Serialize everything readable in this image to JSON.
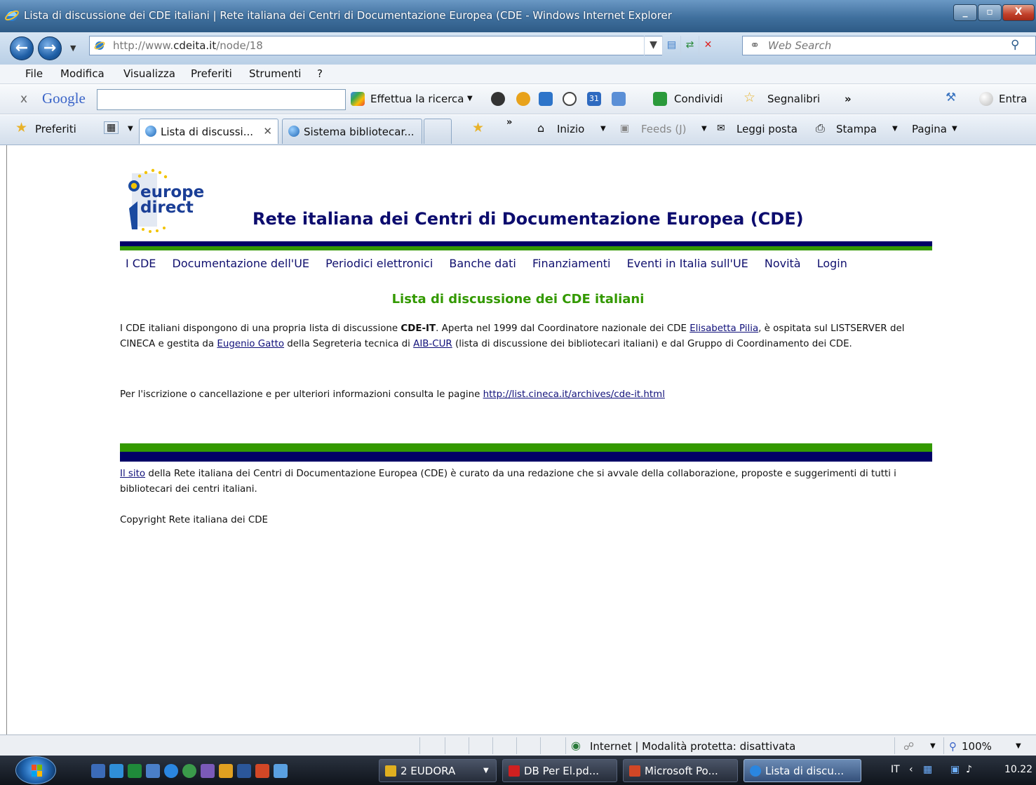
{
  "window": {
    "title": "Lista di discussione dei CDE italiani | Rete italiana dei Centri di Documentazione Europea (CDE - Windows Internet Explorer",
    "minimize": "_",
    "maximize": "▫",
    "close": "X"
  },
  "address": {
    "url_prefix": "http://www.",
    "url_domain": "cdeita.it",
    "url_path": "/node/18",
    "search_placeholder": "Web Search"
  },
  "menu": [
    "File",
    "Modifica",
    "Visualizza",
    "Preferiti",
    "Strumenti",
    "?"
  ],
  "google_toolbar": {
    "close": "x",
    "logo": "Google",
    "search_label": "Effettua la ricerca",
    "share_label": "Condividi",
    "bookmarks_label": "Segnalibri",
    "more": "»",
    "signin_label": "Entra"
  },
  "favorites_bar": {
    "favorites_label": "Preferiti",
    "tabs": [
      {
        "label": "Lista di discussi...",
        "active": true
      },
      {
        "label": "Sistema bibliotecar...",
        "active": false
      }
    ],
    "more": "»",
    "home_label": "Inizio",
    "feeds_label": "Feeds (J)",
    "mail_label": "Leggi posta",
    "print_label": "Stampa",
    "page_label": "Pagina"
  },
  "page": {
    "logo_line1": "europe",
    "logo_line2": "direct",
    "site_title": "Rete italiana dei Centri di Documentazione Europea (CDE)",
    "nav": [
      "I CDE",
      "Documentazione dell'UE",
      "Periodici elettronici",
      "Banche dati",
      "Finanziamenti",
      "Eventi in Italia sull'UE",
      "Novità",
      "Login"
    ],
    "heading": "Lista di discussione dei CDE italiani",
    "p1": {
      "t1": "I CDE italiani dispongono di una propria lista di discussione ",
      "b1": "CDE-IT",
      "t2": ". Aperta nel 1999 dal Coordinatore nazionale dei CDE ",
      "l1": "Elisabetta Pilia",
      "t3": ", è ospitata sul LISTSERVER del CINECA e gestita da ",
      "l2": "Eugenio Gatto",
      "t4": " della Segreteria tecnica di ",
      "l3": "AIB-CUR",
      "t5": " (lista di discussione dei bibliotecari italiani) e dal Gruppo di Coordinamento dei CDE."
    },
    "p2": {
      "t1": "Per l'iscrizione o cancellazione e per ulteriori informazioni consulta le pagine ",
      "l1": "http://list.cineca.it/archives/cde-it.html"
    },
    "footer1": {
      "l1": "Il sito",
      "t1": " della Rete italiana dei Centri di Documentazione Europea (CDE) è curato da una redazione che si avvale della collaborazione, proposte e suggerimenti di tutti i bibliotecari dei centri italiani."
    },
    "copyright": "Copyright Rete italiana dei CDE"
  },
  "status": {
    "zone": "Internet | Modalità protetta: disattivata",
    "zoom": "100%"
  },
  "taskbar": {
    "tasks": [
      {
        "label": "2 EUDORA",
        "active": false
      },
      {
        "label": "DB Per El.pd...",
        "active": false
      },
      {
        "label": "Microsoft Po...",
        "active": false
      },
      {
        "label": "Lista di discu...",
        "active": true
      }
    ],
    "lang": "IT",
    "clock": "10.22"
  },
  "colors": {
    "accent_green": "#339900",
    "accent_navy": "#000066",
    "link": "#10107a"
  }
}
